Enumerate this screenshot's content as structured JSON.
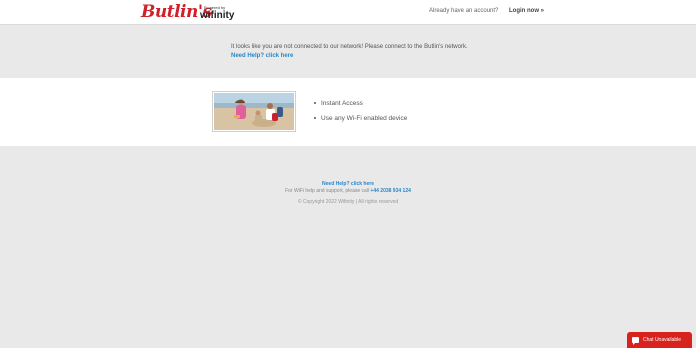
{
  "header": {
    "brand": "Butlin's",
    "powered_by": "Powered by",
    "partner": "wifinity",
    "account_prompt": "Already have an account?",
    "login_label": "Login now »"
  },
  "notice": {
    "message": "It looks like you are not connected to our network! Please connect to the Butlin's network.",
    "help_link": "Need Help? click here"
  },
  "features": {
    "items": [
      "Instant Access",
      "Use any Wi-Fi enabled device"
    ]
  },
  "footer": {
    "help_link": "Need Help? click here",
    "support_text": "For WiFi help and support, please call",
    "phone": "+44 2038 934 124",
    "copyright": "© Copyright 2022 Wifinity | All rights reserved"
  },
  "chat": {
    "label": "Chat Unavailable"
  },
  "colors": {
    "brand_red": "#d0202a",
    "link_blue": "#2a87c7",
    "chat_red": "#d8221d"
  }
}
